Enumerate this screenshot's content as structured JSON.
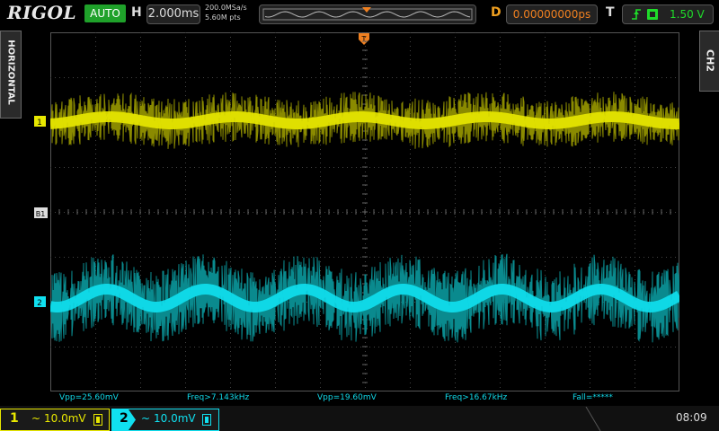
{
  "header": {
    "logo": "RIGOL",
    "run_mode": "AUTO",
    "horizontal_label": "H",
    "timebase": "2.000ms",
    "sample_rate": "200.0MSa/s",
    "memory_depth": "5.60M pts",
    "delay_label": "D",
    "delay_value": "0.00000000ps",
    "trigger_label": "T",
    "trigger_source_icon": "edge-rising-icon",
    "trigger_channel_icon": "ch1-badge-icon",
    "trigger_level": "1.50 V"
  },
  "side_tabs": {
    "left": "HORIZONTAL",
    "right": "CH2"
  },
  "markers": {
    "ch1": "1",
    "ch2": "2",
    "trigger_level_marker": "B1",
    "trigger_position_marker": "T"
  },
  "measurements": [
    {
      "text": "Vpp=25.60mV"
    },
    {
      "text": "Freq>7.143kHz"
    },
    {
      "text": "Vpp=19.60mV"
    },
    {
      "text": "Freq>16.67kHz"
    },
    {
      "text": "Fall=*****"
    }
  ],
  "channels": [
    {
      "number": "1",
      "coupling_icon": "ac-coupling-icon",
      "scale": "10.0mV",
      "color": "#e8e800"
    },
    {
      "number": "2",
      "coupling_icon": "ac-coupling-icon",
      "scale": "10.0mV",
      "color": "#10e0f0"
    }
  ],
  "clock": "08:09",
  "colors": {
    "ch1": "#e8e800",
    "ch1_dim": "#8a8a00",
    "ch2": "#10e0f0",
    "ch2_dim": "#0a8a8e",
    "accent_orange": "#f08020",
    "run_green": "#1fa12a"
  }
}
